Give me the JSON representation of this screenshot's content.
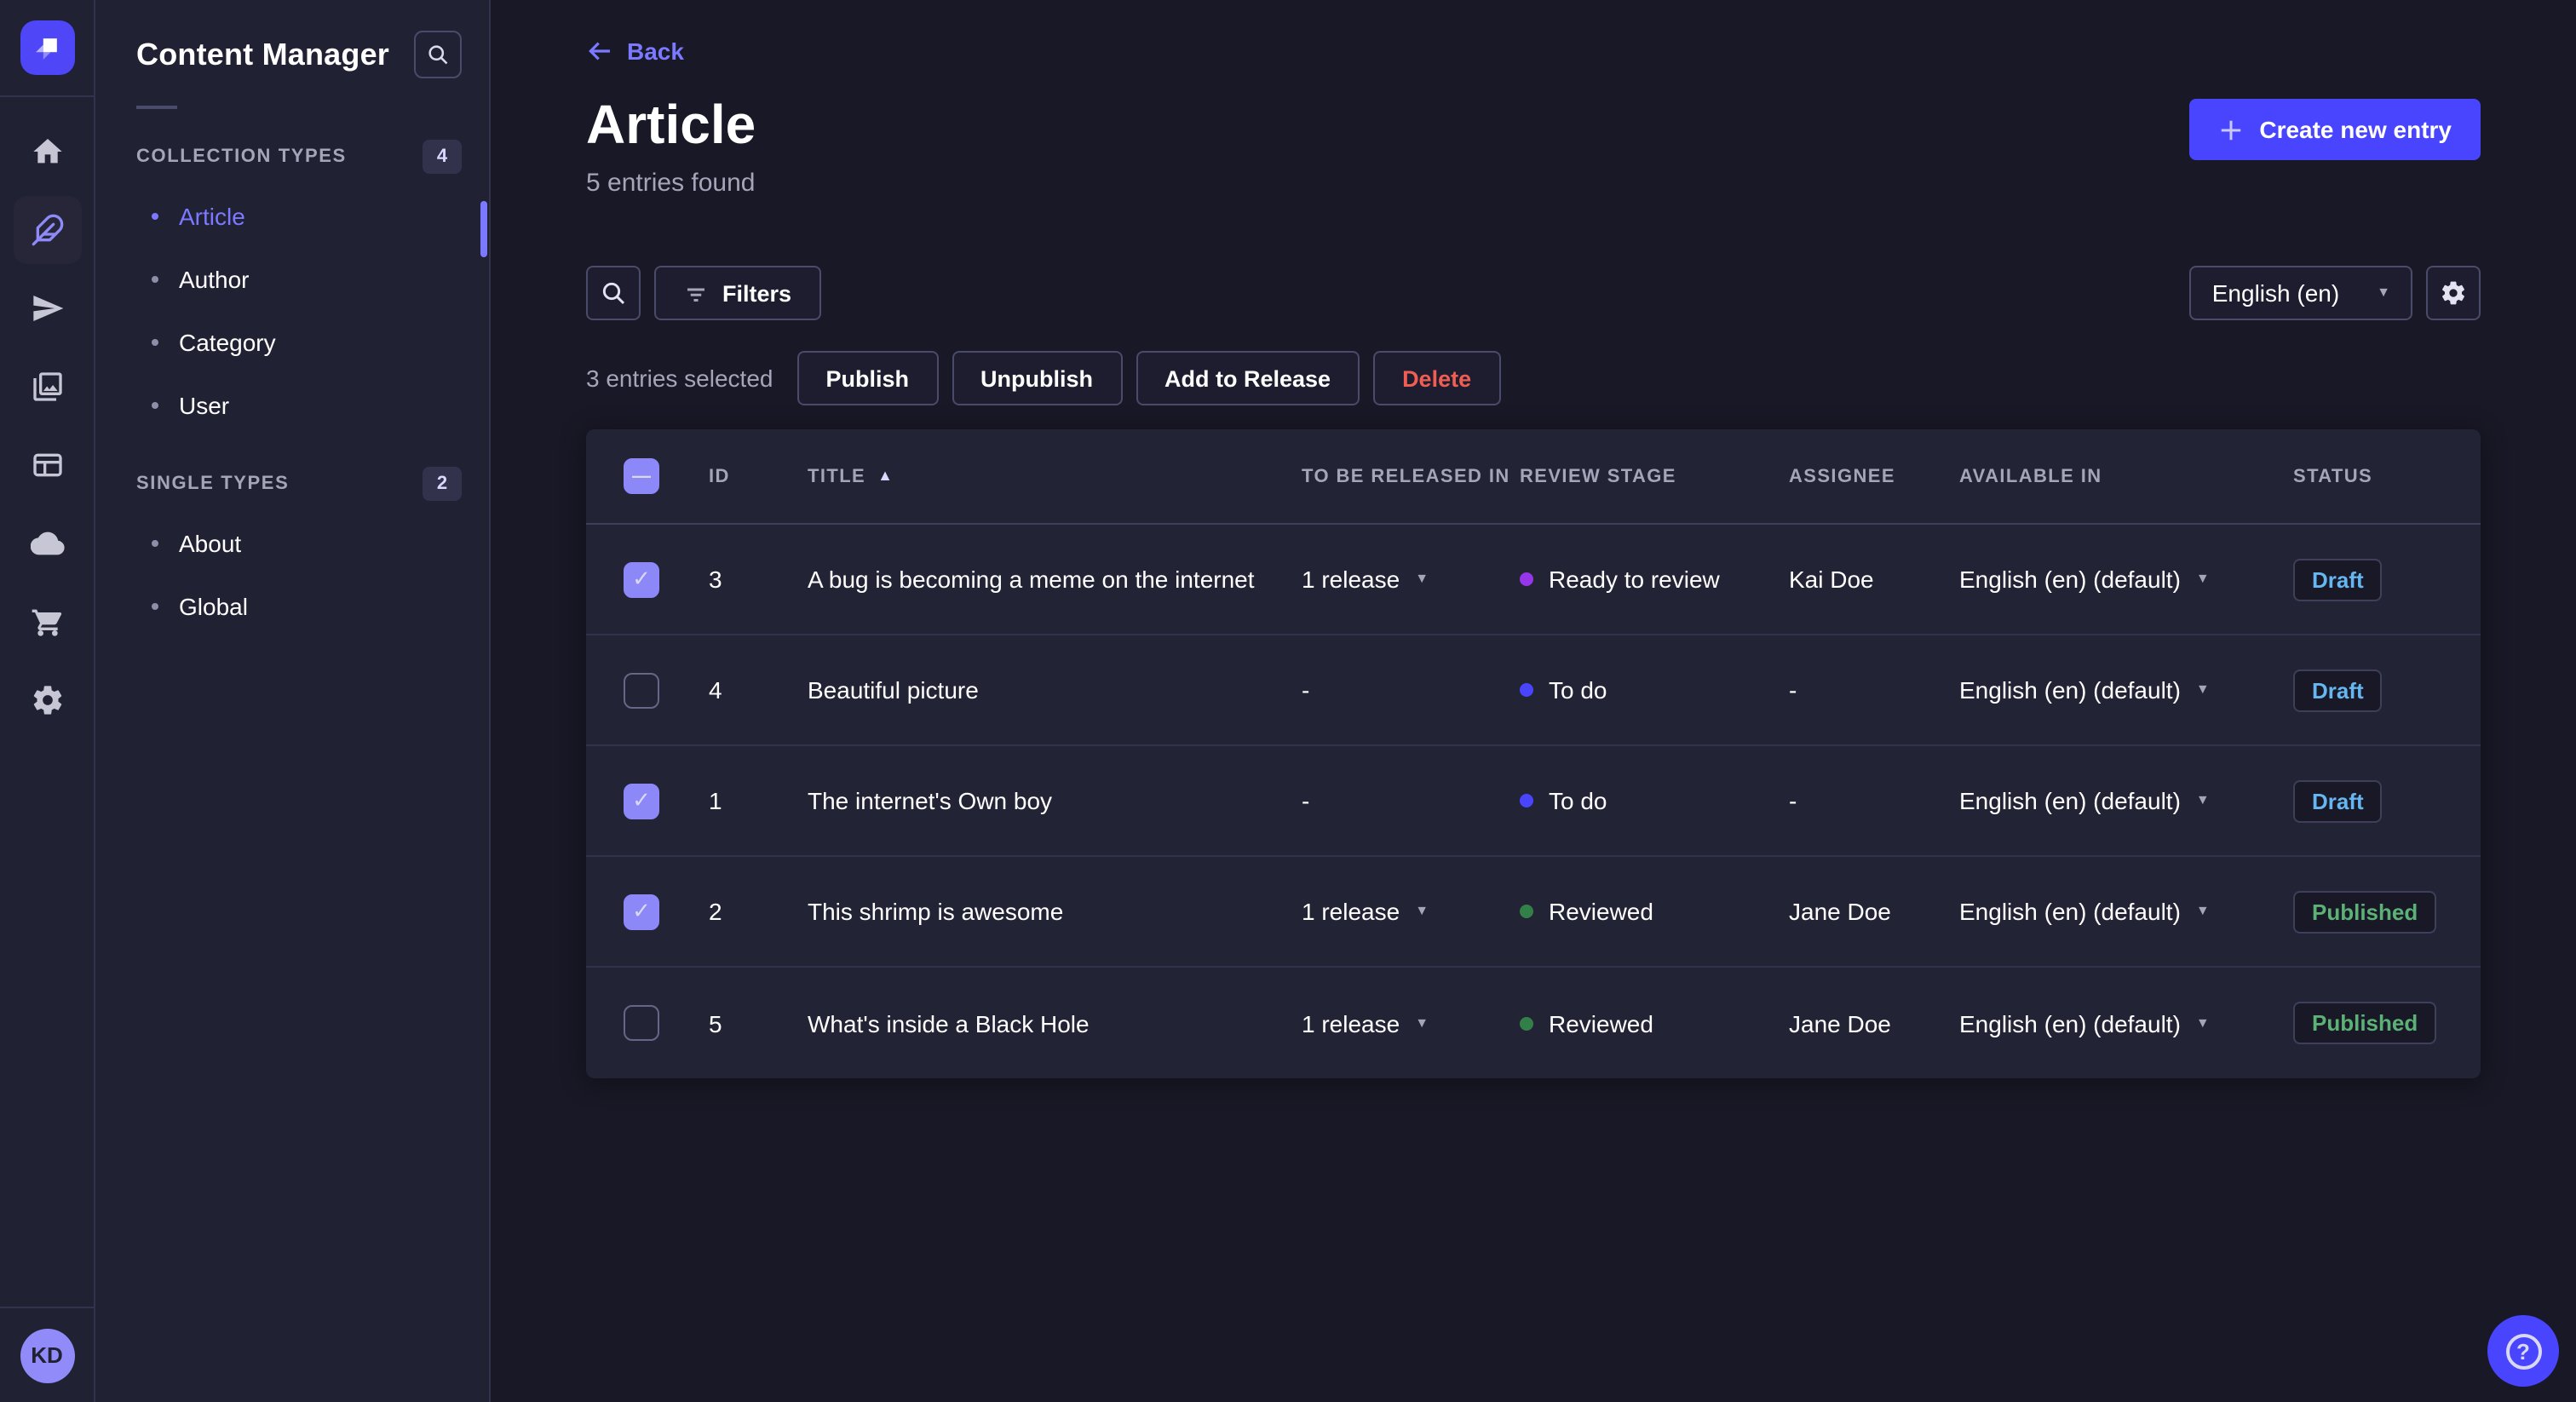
{
  "mainnav": {
    "logo_icon": "strapi-logo",
    "avatar": "KD",
    "items": [
      {
        "icon": "home"
      },
      {
        "icon": "feather",
        "active": true
      },
      {
        "icon": "send"
      },
      {
        "icon": "media"
      },
      {
        "icon": "layout"
      },
      {
        "icon": "cloud"
      },
      {
        "icon": "cart"
      },
      {
        "icon": "gear"
      }
    ]
  },
  "subnav": {
    "title": "Content Manager",
    "search_icon": "search-icon",
    "sections": [
      {
        "label": "COLLECTION TYPES",
        "badge": "4",
        "items": [
          {
            "label": "Article",
            "active": true
          },
          {
            "label": "Author"
          },
          {
            "label": "Category"
          },
          {
            "label": "User"
          }
        ]
      },
      {
        "label": "SINGLE TYPES",
        "badge": "2",
        "items": [
          {
            "label": "About"
          },
          {
            "label": "Global"
          }
        ]
      }
    ]
  },
  "header": {
    "back": "Back",
    "title": "Article",
    "subtitle": "5 entries found",
    "create_label": "Create new entry"
  },
  "toolbar": {
    "search_icon": "search-icon",
    "filters_label": "Filters",
    "locale": "English (en)",
    "settings_icon": "gear-icon"
  },
  "selection": {
    "text": "3 entries selected",
    "actions": [
      {
        "label": "Publish"
      },
      {
        "label": "Unpublish"
      },
      {
        "label": "Add to Release"
      },
      {
        "label": "Delete",
        "variant": "danger"
      }
    ]
  },
  "table": {
    "columns": [
      "ID",
      "TITLE",
      "TO BE RELEASED IN",
      "REVIEW STAGE",
      "ASSIGNEE",
      "AVAILABLE IN",
      "STATUS"
    ],
    "sorted_column": "TITLE",
    "sort_direction": "asc",
    "rows": [
      {
        "checked": true,
        "id": "3",
        "title": "A bug is becoming a meme on the internet",
        "to_be_released_in": "1 release",
        "review_stage": "Ready to review",
        "stage_color": "#9736e8",
        "assignee": "Kai Doe",
        "available_in": "English (en) (default)",
        "status": "Draft"
      },
      {
        "checked": false,
        "id": "4",
        "title": "Beautiful picture",
        "to_be_released_in": "-",
        "review_stage": "To do",
        "stage_color": "#4945ff",
        "assignee": "-",
        "available_in": "English (en) (default)",
        "status": "Draft"
      },
      {
        "checked": true,
        "id": "1",
        "title": "The internet's Own boy",
        "to_be_released_in": "-",
        "review_stage": "To do",
        "stage_color": "#4945ff",
        "assignee": "-",
        "available_in": "English (en) (default)",
        "status": "Draft"
      },
      {
        "checked": true,
        "id": "2",
        "title": "This shrimp is awesome",
        "to_be_released_in": "1 release",
        "review_stage": "Reviewed",
        "stage_color": "#328048",
        "assignee": "Jane Doe",
        "available_in": "English (en) (default)",
        "status": "Published"
      },
      {
        "checked": false,
        "id": "5",
        "title": "What's inside a Black Hole",
        "to_be_released_in": "1 release",
        "review_stage": "Reviewed",
        "stage_color": "#328048",
        "assignee": "Jane Doe",
        "available_in": "English (en) (default)",
        "status": "Published"
      }
    ]
  },
  "help": {
    "icon": "question-mark-icon"
  },
  "colors": {
    "page_bg": "#181826",
    "panel_bg": "#212134",
    "card_bg": "#232336",
    "border": "#32324d",
    "border_light": "#4a4a6a",
    "text_muted": "#a5a5ba",
    "accent": "#7b79ff",
    "primary": "#4945ff",
    "danger": "#ee5e52",
    "draft": "#66b7f1",
    "published": "#5cb176",
    "stage_todo": "#4945ff",
    "stage_ready": "#9736e8",
    "stage_reviewed": "#328048"
  }
}
